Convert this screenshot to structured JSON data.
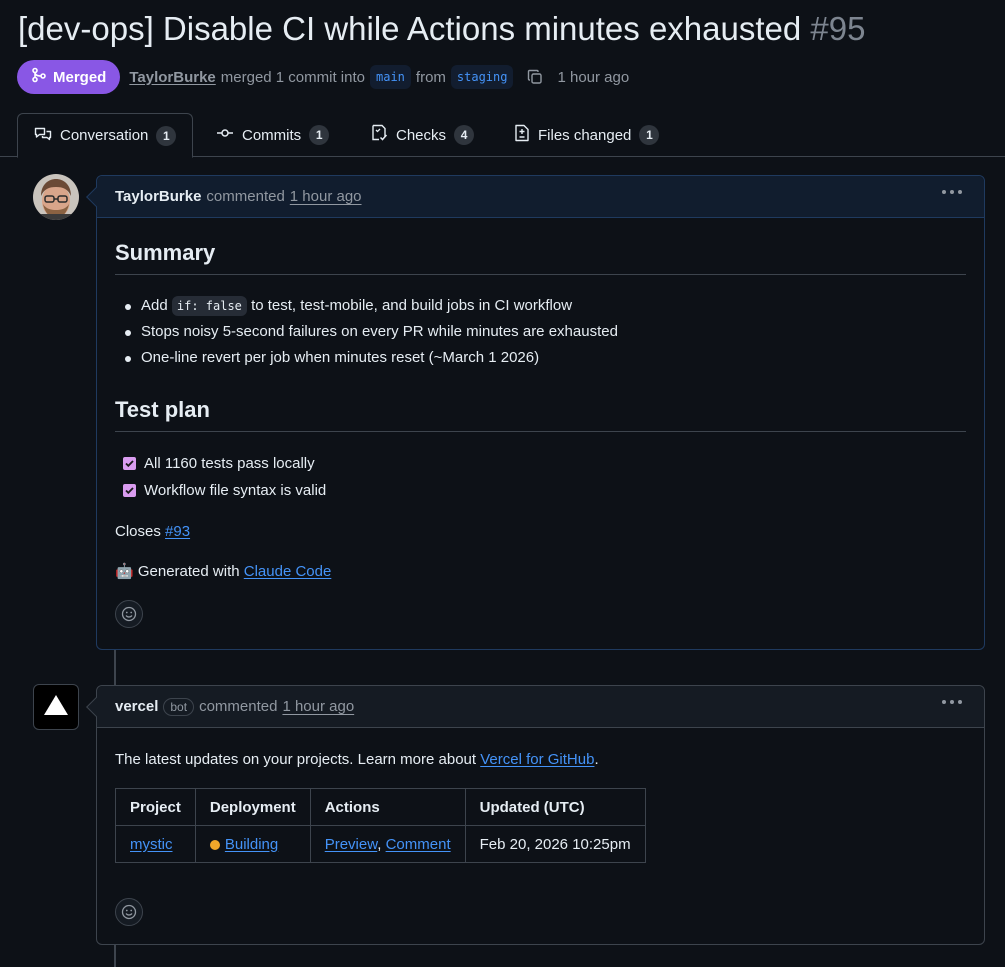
{
  "pr": {
    "title": "[dev-ops] Disable CI while Actions minutes exhausted",
    "number": "#95",
    "state": "Merged",
    "author": "TaylorBurke",
    "merged_text": "merged 1 commit into",
    "base_branch": "main",
    "from_text": "from",
    "head_branch": "staging",
    "time": "1 hour ago"
  },
  "tabs": [
    {
      "label": "Conversation",
      "count": "1"
    },
    {
      "label": "Commits",
      "count": "1"
    },
    {
      "label": "Checks",
      "count": "4"
    },
    {
      "label": "Files changed",
      "count": "1"
    }
  ],
  "comment1": {
    "author": "TaylorBurke",
    "action": "commented",
    "time": "1 hour ago",
    "summary_heading": "Summary",
    "bullet1_pre": "Add",
    "bullet1_code": "if: false",
    "bullet1_post": "to test, test-mobile, and build jobs in CI workflow",
    "bullet2": "Stops noisy 5-second failures on every PR while minutes are exhausted",
    "bullet3": "One-line revert per job when minutes reset (~March 1 2026)",
    "testplan_heading": "Test plan",
    "task1": "All 1160 tests pass locally",
    "task2": "Workflow file syntax is valid",
    "closes_label": "Closes",
    "closes_link": "#93",
    "generated_emoji": "🤖",
    "generated_label": "Generated with",
    "generated_link": "Claude Code"
  },
  "comment2": {
    "author": "vercel",
    "bot_label": "bot",
    "action": "commented",
    "time": "1 hour ago",
    "intro": "The latest updates on your projects. Learn more about",
    "intro_link": "Vercel for GitHub",
    "intro_end": ".",
    "table": {
      "headers": [
        "Project",
        "Deployment",
        "Actions",
        "Updated (UTC)"
      ],
      "row": {
        "project": "mystic",
        "deployment": "Building",
        "action1": "Preview",
        "sep": ",",
        "action2": "Comment",
        "updated": "Feb 20, 2026 10:25pm"
      }
    }
  },
  "colors": {
    "merged": "#8957e5",
    "link": "#4493f8",
    "building_dot": "#f0a62a"
  }
}
